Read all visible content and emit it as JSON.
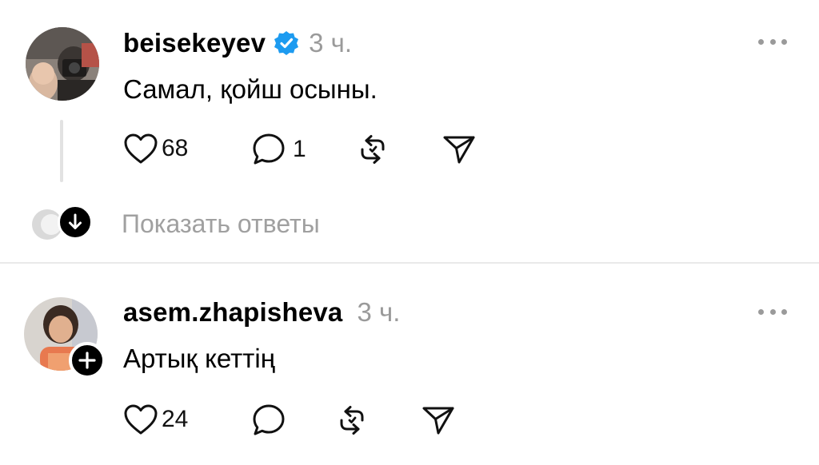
{
  "posts": [
    {
      "username": "beisekeyev",
      "verified": true,
      "time": "3 ч.",
      "text": "Самал, қойш осыны.",
      "likes": "68",
      "comments": "1"
    },
    {
      "username": "asem.zhapisheva",
      "verified": false,
      "time": "3 ч.",
      "text": "Артық кеттің",
      "likes": "24",
      "comments": ""
    }
  ],
  "show_replies_label": "Показать ответы",
  "colors": {
    "verified_badge": "#1d9bf0",
    "muted_text": "#9a9a9a",
    "divider": "#e9e9e9"
  }
}
